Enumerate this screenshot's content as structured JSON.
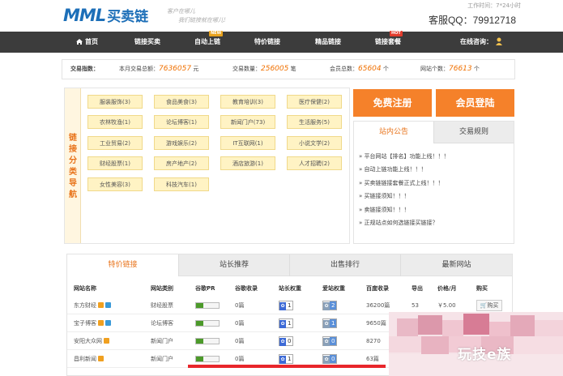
{
  "header": {
    "logo_mark": "MML",
    "logo_text": "买卖链",
    "slogan_line1": "客户在哪儿",
    "slogan_line2": "我们链接就在哪儿!",
    "work_time": "工作时间：7*24小时",
    "service_qq": "客服QQ：79912718"
  },
  "nav": {
    "items": [
      {
        "label": "首页",
        "icon": "home-icon"
      },
      {
        "label": "链接买卖"
      },
      {
        "label": "自动上链",
        "badge": "NEW"
      },
      {
        "label": "特价链接"
      },
      {
        "label": "精品链接"
      },
      {
        "label": "链接套餐",
        "badge": "HOT"
      }
    ],
    "consult_label": "在线咨询：",
    "consult_icon": "chat-person-icon"
  },
  "stats": {
    "monthly_label": "本月交易总额：",
    "monthly_value": "7636057",
    "monthly_unit": "元",
    "count_label": "交易数量：",
    "count_value": "256005",
    "count_unit": "笔",
    "members_label": "会员总数：",
    "members_value": "65604",
    "members_unit": "个",
    "sites_label": "网站个数：",
    "sites_value": "76613",
    "sites_unit": "个",
    "heading": "交易指数："
  },
  "categories": {
    "side_title": "链接分类导航",
    "items": [
      "服装服饰(3)",
      "食品美食(3)",
      "教育培训(3)",
      "医疗保健(2)",
      "农林牧渔(1)",
      "论坛博客(1)",
      "新闻门户(73)",
      "生活服务(5)",
      "工业贸易(2)",
      "游戏娱乐(2)",
      "IT互联网(1)",
      "小说文学(2)",
      "财经股票(1)",
      "房产地产(2)",
      "酒店旅游(1)",
      "人才招聘(2)",
      "女性美容(3)",
      "科技汽车(1)"
    ]
  },
  "auth": {
    "register_label": "免费注册",
    "login_label": "会员登陆"
  },
  "notice": {
    "tabs": [
      "站内公告",
      "交易规则"
    ],
    "items": [
      "» 平台网站【排名】功能上线！！！",
      "» 自动上链功能上线！！！",
      "» 买卖链链接套餐正式上线！！！",
      "» 买链接须知！！！",
      "» 卖链接须知！！！",
      "» 正规站点如何选链接买链接？"
    ]
  },
  "listing": {
    "tabs": [
      "特价链接",
      "站长推荐",
      "出售排行",
      "最新网站"
    ],
    "columns": [
      "网站名称",
      "网站类别",
      "谷歌PR",
      "谷歌收录",
      "站长权重",
      "爱站权重",
      "百度收录",
      "导出",
      "价格/月",
      "购买"
    ],
    "rows": [
      {
        "name": "东方财经",
        "category": "财经股票",
        "google_index": "0篇",
        "zz_weight": "1",
        "az_weight": "2",
        "baidu_index": "36200篇",
        "outbound": "53",
        "price": "￥5.00",
        "buy": "购买"
      },
      {
        "name": "宝子博客",
        "category": "论坛博客",
        "google_index": "0篇",
        "zz_weight": "1",
        "az_weight": "1",
        "baidu_index": "9650篇",
        "outbound": "",
        "price": "",
        "buy": ""
      },
      {
        "name": "安阳大众网",
        "category": "新闻门户",
        "google_index": "0篇",
        "zz_weight": "0",
        "az_weight": "0",
        "baidu_index": "8270",
        "outbound": "",
        "price": "",
        "buy": ""
      },
      {
        "name": "昌利新闻",
        "category": "新闻门户",
        "google_index": "0篇",
        "zz_weight": "1",
        "az_weight": "0",
        "baidu_index": "63篇",
        "outbound": "",
        "price": "",
        "buy": ""
      }
    ]
  },
  "overlay": {
    "watermark_text": "玩技e族"
  },
  "colors": {
    "accent_orange": "#f5812a",
    "nav_dark": "#3c3c3c",
    "brand_blue": "#1d6fb8",
    "stat_value": "#f07000"
  }
}
